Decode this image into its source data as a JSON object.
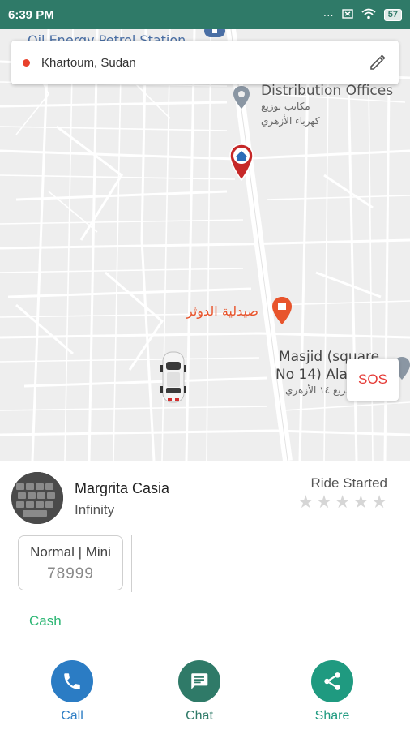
{
  "status_bar": {
    "time": "6:39 PM",
    "icons": [
      "dots-icon",
      "sim-icon",
      "wifi-icon"
    ],
    "battery": "57"
  },
  "location": {
    "text": "Khartoum, Sudan",
    "dot_color": "#e8412c"
  },
  "map": {
    "labels": {
      "station": "Oil Energy Petrol Station",
      "office": "Distribution Offices",
      "office_ar1": "مكاتب توزيع",
      "office_ar2": "كهرباء الأزهري",
      "pharmacy": "صيدلية الدوثر",
      "masjid1": "Masjid (square",
      "masjid2": "No 14) Ala",
      "masjid_ar": "مربع ١٤ الأزهري"
    }
  },
  "sos": {
    "label": "SOS"
  },
  "driver": {
    "name": "Margrita Casia",
    "car": "Infinity",
    "rating": 0
  },
  "ride": {
    "status": "Ride Started"
  },
  "car_info": {
    "type": "Normal | Mini",
    "plate": "78999"
  },
  "payment": {
    "method": "Cash"
  },
  "actions": {
    "call": "Call",
    "chat": "Chat",
    "share": "Share"
  },
  "colors": {
    "header": "#2f7a68",
    "call": "#2b7cc4",
    "chat": "#2f7a68",
    "share": "#1f9a80",
    "cash": "#2bb673",
    "sos": "#e53935"
  }
}
